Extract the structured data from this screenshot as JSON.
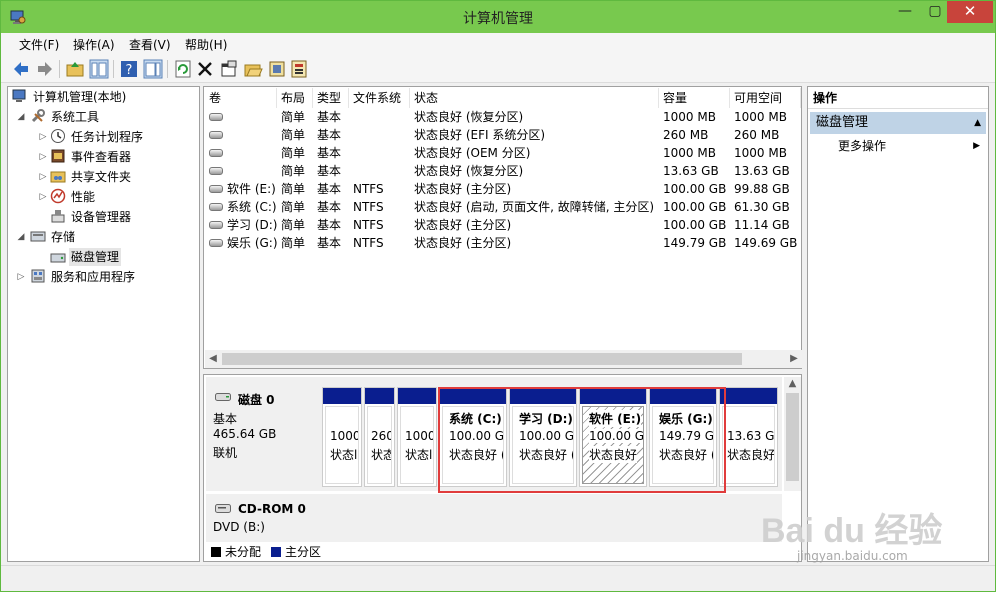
{
  "window": {
    "title": "计算机管理",
    "minimize": "—",
    "maximize": "▢",
    "close": "✕"
  },
  "menu": [
    "文件(F)",
    "操作(A)",
    "查看(V)",
    "帮助(H)"
  ],
  "tree": {
    "root": "计算机管理(本地)",
    "system_tools": "系统工具",
    "task_scheduler": "任务计划程序",
    "event_viewer": "事件查看器",
    "shared_folders": "共享文件夹",
    "performance": "性能",
    "device_manager": "设备管理器",
    "storage": "存储",
    "disk_management": "磁盘管理",
    "services": "服务和应用程序"
  },
  "volumes": {
    "headers": [
      "卷",
      "布局",
      "类型",
      "文件系统",
      "状态",
      "容量",
      "可用空间"
    ],
    "rows": [
      [
        "",
        "简单",
        "基本",
        "",
        "状态良好 (恢复分区)",
        "1000 MB",
        "1000 MB"
      ],
      [
        "",
        "简单",
        "基本",
        "",
        "状态良好 (EFI 系统分区)",
        "260 MB",
        "260 MB"
      ],
      [
        "",
        "简单",
        "基本",
        "",
        "状态良好 (OEM 分区)",
        "1000 MB",
        "1000 MB"
      ],
      [
        "",
        "简单",
        "基本",
        "",
        "状态良好 (恢复分区)",
        "13.63 GB",
        "13.63 GB"
      ],
      [
        "软件 (E:)",
        "简单",
        "基本",
        "NTFS",
        "状态良好 (主分区)",
        "100.00 GB",
        "99.88 GB"
      ],
      [
        "系统 (C:)",
        "简单",
        "基本",
        "NTFS",
        "状态良好 (启动, 页面文件, 故障转储, 主分区)",
        "100.00 GB",
        "61.30 GB"
      ],
      [
        "学习 (D:)",
        "简单",
        "基本",
        "NTFS",
        "状态良好 (主分区)",
        "100.00 GB",
        "11.14 GB"
      ],
      [
        "娱乐 (G:)",
        "简单",
        "基本",
        "NTFS",
        "状态良好 (主分区)",
        "149.79 GB",
        "149.69 GB"
      ]
    ]
  },
  "disk0": {
    "name": "磁盘 0",
    "type": "基本",
    "size": "465.64 GB",
    "status": "联机",
    "partitions": [
      {
        "name": "",
        "size": "1000",
        "status": "状态l"
      },
      {
        "name": "",
        "size": "260",
        "status": "状态"
      },
      {
        "name": "",
        "size": "1000",
        "status": "状态l"
      },
      {
        "name": "系统  (C:)",
        "size": "100.00 GI",
        "status": "状态良好 ("
      },
      {
        "name": "学习  (D:)",
        "size": "100.00 GI",
        "status": "状态良好 ("
      },
      {
        "name": "软件  (E:)",
        "size": "100.00 GI",
        "status": "状态良好"
      },
      {
        "name": "娱乐  (G:)",
        "size": "149.79 GE",
        "status": "状态良好 ("
      },
      {
        "name": "",
        "size": "13.63 GE",
        "status": "状态良好"
      }
    ]
  },
  "cdrom": {
    "name": "CD-ROM 0",
    "drive": "DVD (B:)"
  },
  "legend": {
    "unallocated": "未分配",
    "primary": "主分区"
  },
  "actions": {
    "title": "操作",
    "section": "磁盘管理",
    "more": "更多操作"
  },
  "watermark": {
    "logo": "Bai du 经验",
    "sub": "jingyan.baidu.com"
  },
  "colors": {
    "titlebar": "#78c94e",
    "partition_bar": "#0a1e8f",
    "highlight": "#e03c3c",
    "unallocated": "#000000",
    "primary": "#0a1e8f"
  }
}
